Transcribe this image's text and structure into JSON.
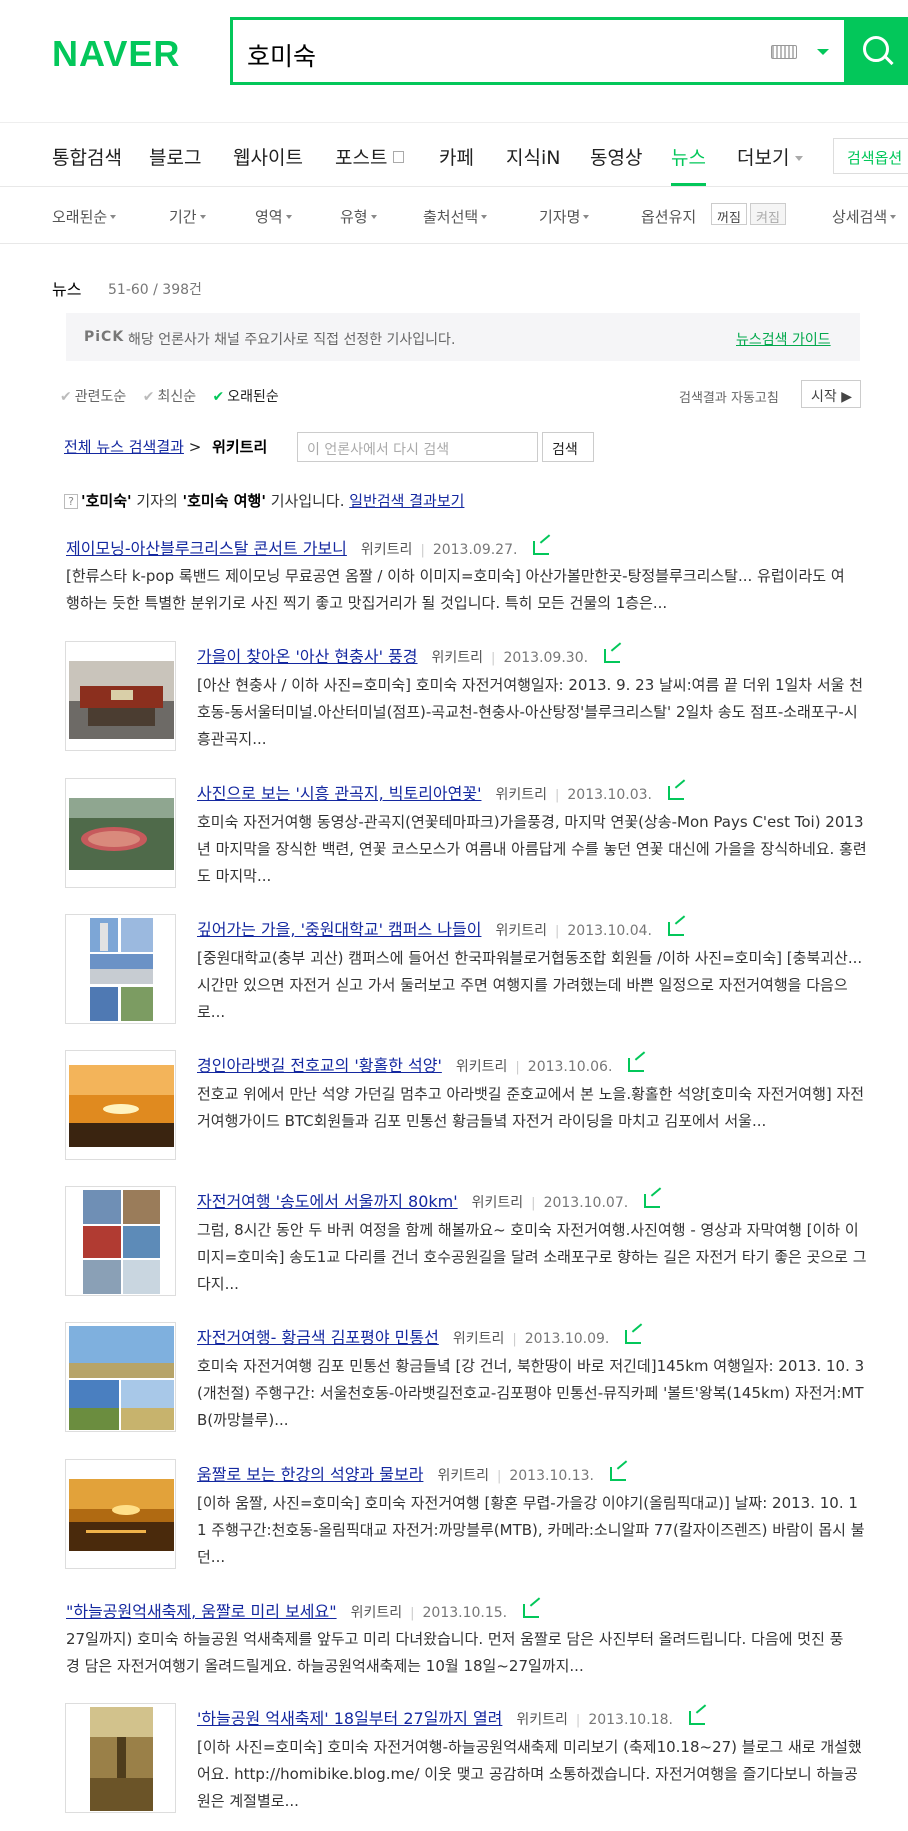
{
  "header": {
    "logo": "NAVER",
    "query": "호미숙"
  },
  "tabs": [
    {
      "label": "통합검색"
    },
    {
      "label": "블로그"
    },
    {
      "label": "웹사이트"
    },
    {
      "label": "포스트"
    },
    {
      "label": "카페"
    },
    {
      "label": "지식iN"
    },
    {
      "label": "동영상"
    },
    {
      "label": "뉴스"
    },
    {
      "label": "더보기"
    }
  ],
  "search_options_label": "검색옵션",
  "filters": [
    {
      "label": "오래된순"
    },
    {
      "label": "기간"
    },
    {
      "label": "영역"
    },
    {
      "label": "유형"
    },
    {
      "label": "출처선택"
    },
    {
      "label": "기자명"
    }
  ],
  "option_keep": {
    "label": "옵션유지",
    "off": "꺼짐",
    "on": "켜짐"
  },
  "detail_search": "상세검색",
  "news": {
    "heading": "뉴스",
    "count": "51-60 / 398건",
    "pick_logo": "PiCK",
    "pick_text": "해당 언론사가 채널 주요기사로 직접 선정한 기사입니다.",
    "pick_guide": "뉴스검색 가이드",
    "sort": [
      "관련도순",
      "최신순",
      "오래된순"
    ],
    "auto_correct": "검색결과 자동고침",
    "start": "시작",
    "breadcrumb_all": "전체 뉴스 검색결과",
    "breadcrumb_current": "위키트리",
    "within_placeholder": "이 언론사에서 다시 검색",
    "within_button": "검색",
    "notice_q": "?",
    "notice_a": "'호미숙'",
    "notice_b": " 기자의 ",
    "notice_c": "'호미숙 여행'",
    "notice_d": " 기사입니다. ",
    "notice_link": "일반검색 결과보기"
  },
  "results": [
    {
      "title": "제이모닝-아산블루크리스탈 콘서트 가보니",
      "press": "위키트리",
      "date": "2013.09.27.",
      "desc": "[한류스타 k-pop 록밴드 제이모닝 무료공연 옴짤 / 이하 이미지=호미숙] 아산가볼만한곳-탕정블루크리스탈... 유럽이라도 여행하는 듯한 특별한 분위기로 사진 찍기 좋고 맛집거리가 될 것입니다. 특히 모든 건물의 1층은..."
    },
    {
      "title": "가을이 찾아온 '아산 현충사' 풍경",
      "press": "위키트리",
      "date": "2013.09.30.",
      "desc": "[아산 현충사 / 이하 사진=호미숙] 호미숙 자전거여행일자: 2013. 9. 23 날씨:여름 끝 더위 1일차 서울 천호동-동서울터미널.아산터미널(점프)-곡교천-현충사-아산탕정'블루크리스탈' 2일차 송도 점프-소래포구-시흥관곡지..."
    },
    {
      "title": "사진으로 보는 '시흥 관곡지, 빅토리아연꽃'",
      "press": "위키트리",
      "date": "2013.10.03.",
      "desc": "호미숙 자전거여행 동영상-관곡지(연꽃테마파크)가을풍경, 마지막 연꽃(상송-Mon Pays C'est Toi) 2013년 마지막을 장식한 백련, 연꽃 코스모스가 여름내 아름답게 수를 놓던 연꽃 대신에 가을을 장식하네요. 홍련도 마지막..."
    },
    {
      "title": "깊어가는 가을, '중원대학교' 캠퍼스 나들이",
      "press": "위키트리",
      "date": "2013.10.04.",
      "desc": "[중원대학교(충부 괴산) 캠퍼스에 들어선 한국파워블로거협동조합 회원들 /이하 사진=호미숙] [충북괴산... 시간만 있으면 자전거 싣고 가서 둘러보고 주면 여행지를 가려했는데 바쁜 일정으로 자전거여행을 다음으로..."
    },
    {
      "title": "경인아라뱃길 전호교의 '황홀한 석양'",
      "press": "위키트리",
      "date": "2013.10.06.",
      "desc": "전호교 위에서 만난 석양 가던길 멈추고 아라뱃길 준호교에서 본 노을.황홀한 석양[호미숙 자전거여행] 자전거여행가이드 BTC회원들과 김포 민통선 황금들녘 자전거 라이딩을 마치고 김포에서 서울..."
    },
    {
      "title": "자전거여행 '송도에서 서울까지 80km'",
      "press": "위키트리",
      "date": "2013.10.07.",
      "desc": "그럼, 8시간 동안 두 바퀴 여정을 함께 해볼까요~ 호미숙 자전거여행.사진여행 - 영상과 자막여행 [이하 이미지=호미숙] 송도1교 다리를 건너 호수공원길을 달려 소래포구로 향하는 길은 자전거 타기 좋은 곳으로 그다지..."
    },
    {
      "title": "자전거여행- 황금색 김포평야 민통선",
      "press": "위키트리",
      "date": "2013.10.09.",
      "desc": "호미숙 자전거여행 김포 민통선 황금들녘 [강 건너, 북한땅이 바로 저긴데]145km 여행일자: 2013. 10. 3(개천절) 주행구간: 서울천호동-아라뱃길전호교-김포평야 민통선-뮤직카페 '볼트'왕복(145km) 자전거:MTB(까망블루)..."
    },
    {
      "title": "움짤로 보는 한강의 석양과 물보라",
      "press": "위키트리",
      "date": "2013.10.13.",
      "desc": "[이하 움짤, 사진=호미숙] 호미숙 자전거여행 [황혼 무렵-가을강 이야기(올림픽대교)] 날짜: 2013. 10. 11 주행구간:천호동-올림픽대교 자전거:까망블루(MTB), 카메라:소니알파 77(칼자이즈렌즈) 바람이 몹시 불던..."
    },
    {
      "title": "\"하늘공원억새축제, 움짤로 미리 보세요\"",
      "press": "위키트리",
      "date": "2013.10.15.",
      "desc": "27일까지) 호미숙 하늘공원 억새축제를 앞두고 미리 다녀왔습니다. 먼저 움짤로 담은 사진부터 올려드립니다. 다음에 멋진 풍경 담은 자전거여행기 올려드릴게요. 하늘공원억새축제는 10월 18일~27일까지..."
    },
    {
      "title": "'하늘공원 억새축제' 18일부터 27일까지 열려",
      "press": "위키트리",
      "date": "2013.10.18.",
      "desc": "[이하 사진=호미숙] 호미숙 자전거여행-하늘공원억새축제 미리보기 (축제10.18~27) 블로그 새로 개설했어요. http://homibike.blog.me/ 이웃 맺고 공감하며 소통하겠습니다. 자전거여행을 즐기다보니 하늘공원은 계절별로..."
    }
  ]
}
